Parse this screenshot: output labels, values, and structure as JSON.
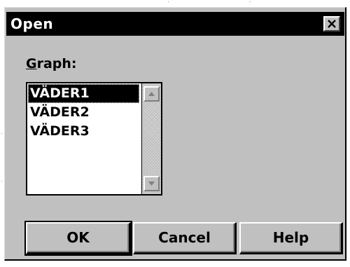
{
  "dialog": {
    "title": "Open",
    "close_glyph": "✕"
  },
  "graph": {
    "label_underlined": "G",
    "label_rest": "raph:",
    "items": [
      "VÄDER1",
      "VÄDER2",
      "VÄDER3"
    ],
    "selected": "VÄDER1"
  },
  "buttons": {
    "ok": "OK",
    "cancel": "Cancel",
    "help": "Help"
  },
  "icons": {
    "close": "close-icon",
    "scroll_up": "scroll-up-arrow-icon",
    "scroll_down": "scroll-down-arrow-icon"
  },
  "colors": {
    "titlebar": "#000000",
    "face": "#c0c0c0",
    "selection": "#000000"
  }
}
